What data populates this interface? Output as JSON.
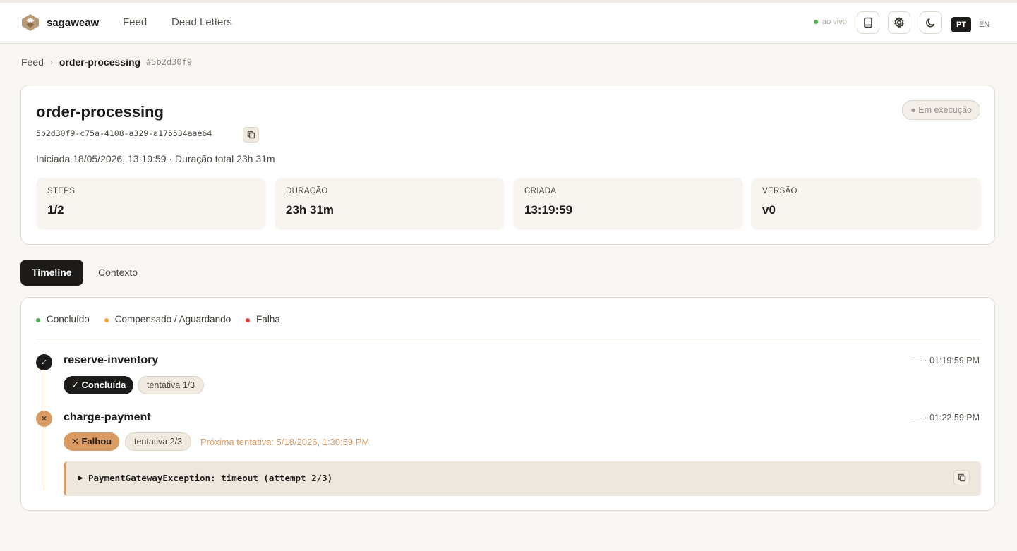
{
  "header": {
    "brand": "sagaweaw",
    "nav": [
      "Feed",
      "Dead Letters"
    ],
    "live_label": "ao vivo",
    "lang_active": "PT",
    "lang_other": "EN"
  },
  "breadcrumb": {
    "root": "Feed",
    "current": "order-processing",
    "hash": "#5b2d30f9"
  },
  "saga": {
    "title": "order-processing",
    "id": "5b2d30f9-c75a-4108-a329-a175534aae64",
    "status": "● Em execução",
    "meta": "Iniciada 18/05/2026, 13:19:59 · Duração total 23h 31m",
    "stats": [
      {
        "label": "STEPS",
        "value": "1/2"
      },
      {
        "label": "DURAÇÃO",
        "value": "23h 31m"
      },
      {
        "label": "CRIADA",
        "value": "13:19:59"
      },
      {
        "label": "VERSÃO",
        "value": "v0"
      }
    ]
  },
  "tabs": [
    "Timeline",
    "Contexto"
  ],
  "legend": [
    {
      "label": "Concluído",
      "color": "#4caf50"
    },
    {
      "label": "Compensado / Aguardando",
      "color": "#f0a830"
    },
    {
      "label": "Falha",
      "color": "#e53935"
    }
  ],
  "steps": [
    {
      "name": "reserve-inventory",
      "time": "— · 01:19:59 PM",
      "badge": "✓ Concluída",
      "attempt": "tentativa 1/3"
    },
    {
      "name": "charge-payment",
      "time": "— · 01:22:59 PM",
      "badge": "✕ Falhou",
      "attempt": "tentativa 2/3",
      "retry": "Próxima tentativa: 5/18/2026, 1:30:59 PM",
      "error": "PaymentGatewayException: timeout (attempt 2/3)"
    }
  ],
  "colors": {
    "accent_dark": "#1c1b19",
    "fail": "#d99a64",
    "background": "#f8f6f2"
  }
}
